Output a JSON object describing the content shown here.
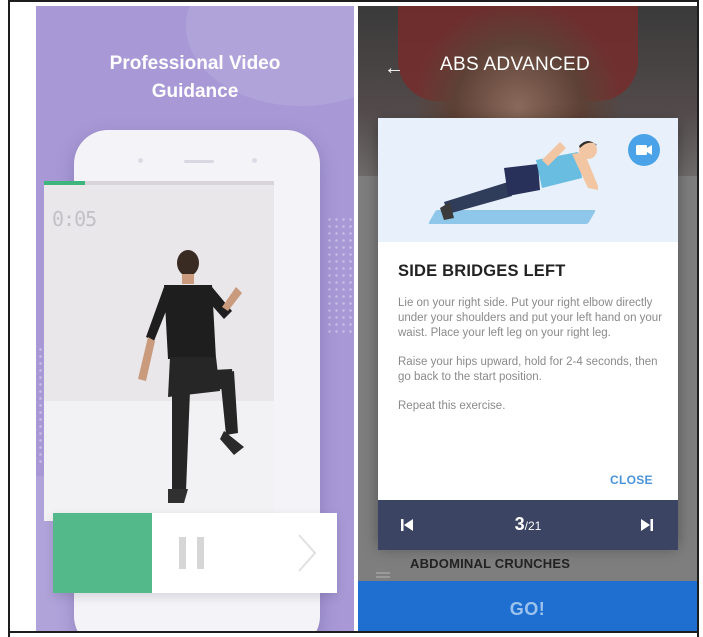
{
  "left_screen": {
    "promo_title": "Professional Video Guidance",
    "video_timer": "0:05",
    "video_progress": 0.18,
    "exercise_progress": 0.35
  },
  "right_screen": {
    "title": "ABS ADVANCED",
    "dialog": {
      "heading": "SIDE BRIDGES LEFT",
      "paragraphs": [
        "Lie on your right side. Put your right elbow directly under your shoulders and put your left hand on your waist. Place your left leg on your right leg.",
        "Raise your hips upward, hold for 2-4 seconds, then go back to the start position.",
        "Repeat this exercise."
      ],
      "close_label": "CLOSE"
    },
    "navigator": {
      "current": "3",
      "total": "/21"
    },
    "next_exercise": "ABDOMINAL CRUNCHES",
    "go_label": "GO!"
  },
  "colors": {
    "left_background": "#a899d6",
    "accent_green": "#54b98a",
    "go_blue": "#1f6fd0",
    "nav_bar": "#3b4462",
    "close_blue": "#4a94d8"
  },
  "icons": [
    "back-arrow-icon",
    "video-camera-icon",
    "skip-previous-icon",
    "skip-next-icon",
    "pause-icon",
    "chevron-right-icon",
    "drag-handle-icon"
  ]
}
